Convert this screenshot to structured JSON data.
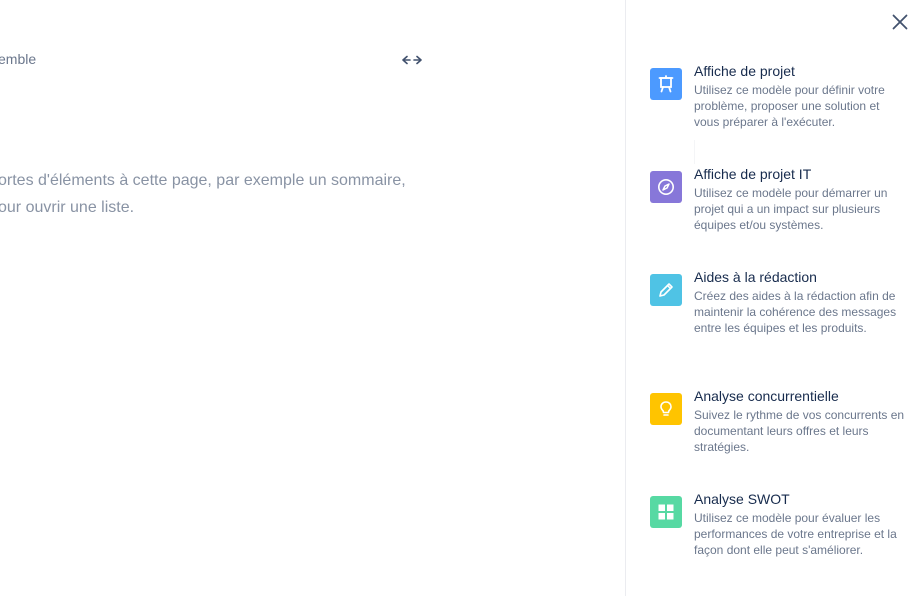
{
  "editor": {
    "title_fragment": "emble",
    "width_toggle_icon": "arrows-horizontal-icon",
    "placeholder_line1": "ortes d'éléments à cette page, par exemple un sommaire,",
    "placeholder_line2": "our ouvrir une liste."
  },
  "panel": {
    "close_icon": "close-icon",
    "templates": [
      {
        "title": "Affiche de projet",
        "description": "Utilisez ce modèle pour définir votre problème, proposer une solution et vous préparer à l'exécuter.",
        "icon": "easel-icon",
        "color": "#4c9aff"
      },
      {
        "title": "Affiche de projet IT",
        "description": "Utilisez ce modèle pour démarrer un projet qui a un impact sur plusieurs équipes et/ou systèmes.",
        "icon": "compass-icon",
        "color": "#8777d9"
      },
      {
        "title": "Aides à la rédaction",
        "description": "Créez des aides à la rédaction afin de maintenir la cohérence des messages entre les équipes et les produits.",
        "icon": "pencil-icon",
        "color": "#4fc3e5"
      },
      {
        "title": "Analyse concurrentielle",
        "description": "Suivez le rythme de vos concurrents en documentant leurs offres et leurs stratégies.",
        "icon": "lightbulb-icon",
        "color": "#ffc400"
      },
      {
        "title": "Analyse SWOT",
        "description": "Utilisez ce modèle pour évaluer les performances de votre entreprise et la façon dont elle peut s'améliorer.",
        "icon": "grid-icon",
        "color": "#57d9a3"
      }
    ]
  }
}
